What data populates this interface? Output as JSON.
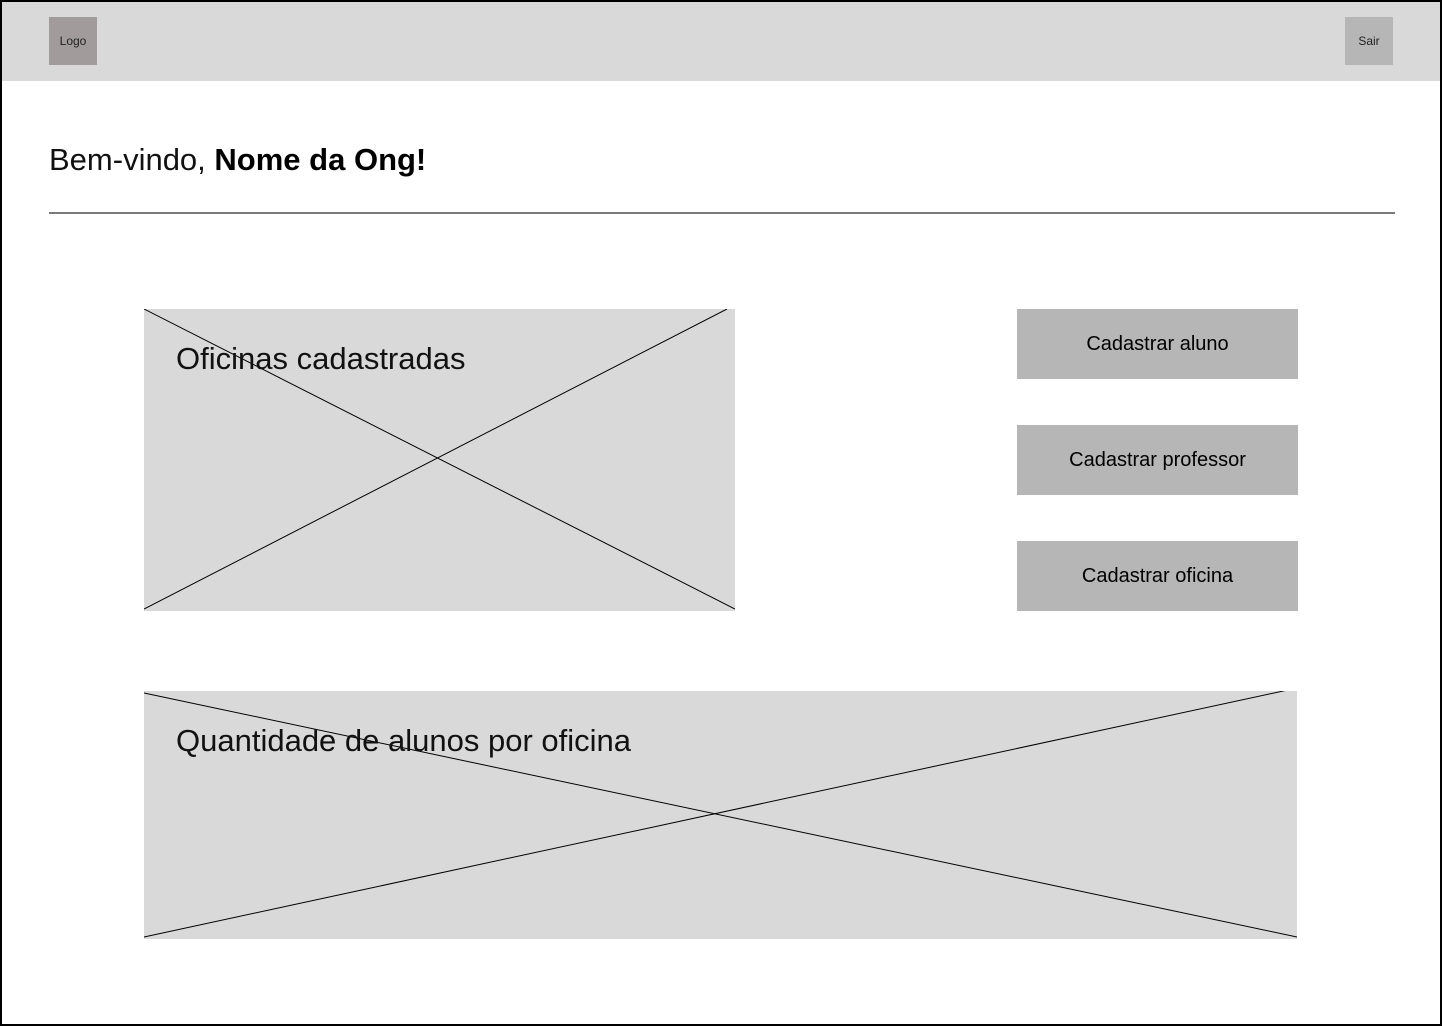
{
  "header": {
    "logo_label": "Logo",
    "logout_label": "Sair"
  },
  "welcome": {
    "greeting": "Bem-vindo,",
    "org_name": "Nome da Ong!"
  },
  "panels": {
    "oficinas_title": "Oficinas cadastradas",
    "quantidade_title": "Quantidade de alunos por oficina"
  },
  "actions": {
    "cadastrar_aluno": "Cadastrar aluno",
    "cadastrar_professor": "Cadastrar professor",
    "cadastrar_oficina": "Cadastrar oficina"
  },
  "colors": {
    "header_bg": "#d9d9d9",
    "logo_bg": "#a19b9b",
    "button_bg": "#b6b6b6",
    "placeholder_bg": "#d9d9d9"
  }
}
